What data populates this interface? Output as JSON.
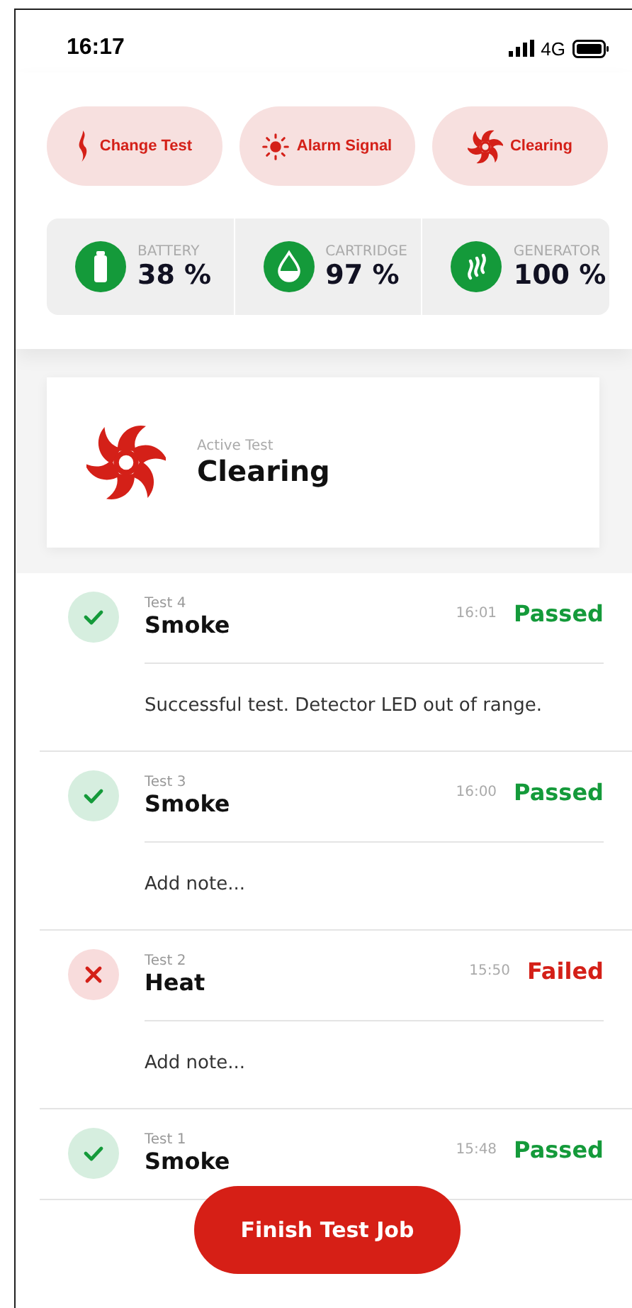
{
  "status_bar": {
    "time": "16:17",
    "network": "4G"
  },
  "actions": [
    {
      "kind": "flame",
      "label": "Change Test"
    },
    {
      "kind": "sun",
      "label": "Alarm Signal"
    },
    {
      "kind": "fan",
      "label": "Clearing"
    }
  ],
  "stats": [
    {
      "kind": "battery",
      "label": "BATTERY",
      "value": "38 %"
    },
    {
      "kind": "drop",
      "label": "CARTRIDGE",
      "value": "97 %"
    },
    {
      "kind": "heat",
      "label": "GENERATOR",
      "value": "100 %"
    }
  ],
  "active_test": {
    "kind": "fan",
    "caption": "Active Test",
    "name": "Clearing"
  },
  "tests": [
    {
      "number": "Test 4",
      "name": "Smoke",
      "time": "16:01",
      "result": "Passed",
      "passed": true,
      "note": "Successful test. Detector LED out of range."
    },
    {
      "number": "Test 3",
      "name": "Smoke",
      "time": "16:00",
      "result": "Passed",
      "passed": true,
      "placeholder": "Add note..."
    },
    {
      "number": "Test 2",
      "name": "Heat",
      "time": "15:50",
      "result": "Failed",
      "passed": false,
      "placeholder": "Add note..."
    },
    {
      "number": "Test 1",
      "name": "Smoke",
      "time": "15:48",
      "result": "Passed",
      "passed": true
    }
  ],
  "finish_button": "Finish Test Job"
}
